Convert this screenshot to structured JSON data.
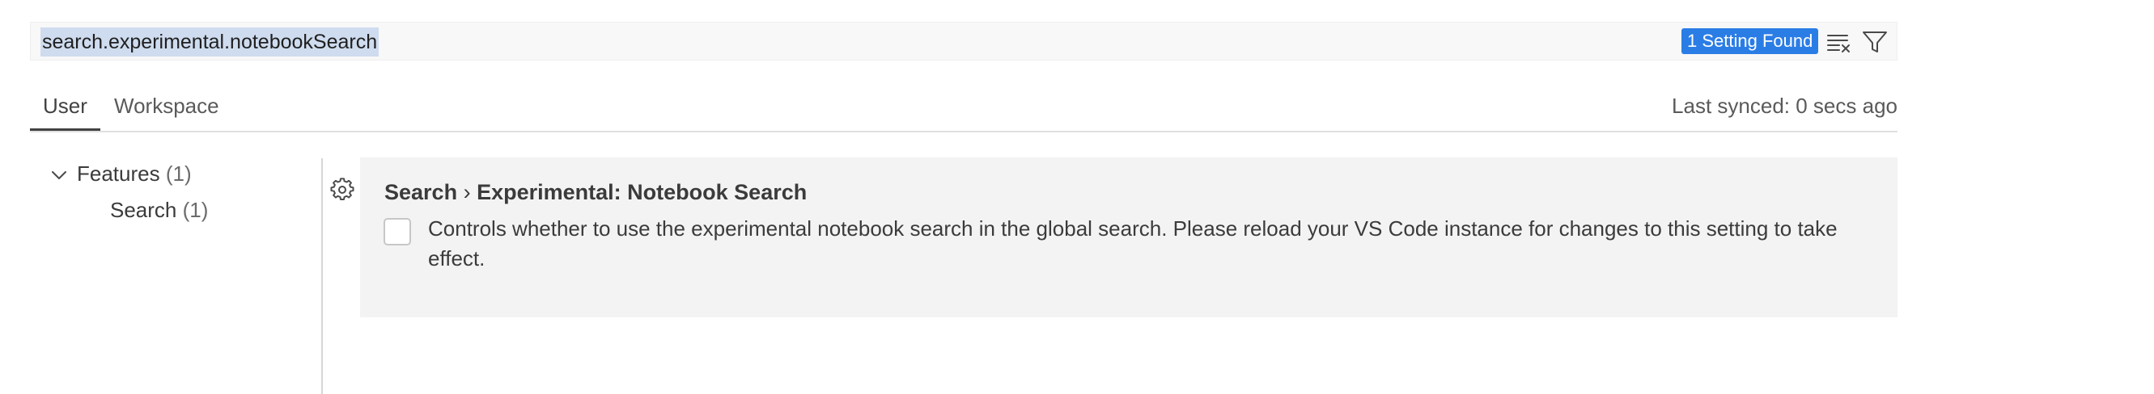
{
  "search": {
    "query": "search.experimental.notebookSearch",
    "results_badge": "1 Setting Found",
    "clear_filter_icon": "clear-filter-icon",
    "filter_icon": "filter-icon"
  },
  "tabs": [
    {
      "label": "User",
      "active": true
    },
    {
      "label": "Workspace",
      "active": false
    }
  ],
  "sync_status": "Last synced: 0 secs ago",
  "toc": {
    "features": {
      "label": "Features",
      "count": "(1)",
      "expanded": true
    },
    "search": {
      "label": "Search",
      "count": "(1)"
    }
  },
  "setting": {
    "category": "Search",
    "separator": "›",
    "name_prefix": "Experimental:",
    "name": "Notebook Search",
    "checked": false,
    "description": "Controls whether to use the experimental notebook search in the global search. Please reload your VS Code instance for changes to this setting to take effect.",
    "gear_icon": "gear-icon"
  },
  "colors": {
    "badge_background": "#2b7de6",
    "selection_highlight": "#cfdcef",
    "setting_background": "#f3f3f3"
  }
}
